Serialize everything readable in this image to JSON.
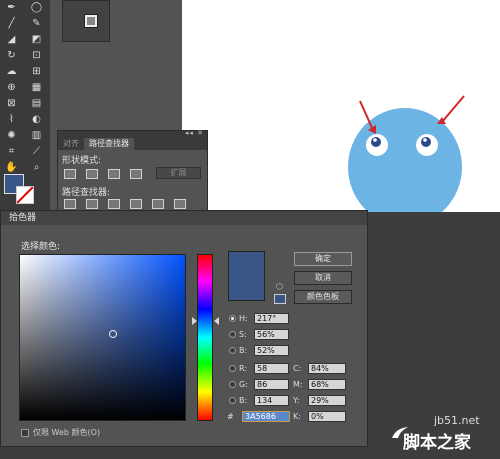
{
  "toolbar": {
    "tools": [
      [
        "pen-icon",
        "ellipse-icon"
      ],
      [
        "brush-icon",
        "pencil-icon"
      ],
      [
        "blob-brush-icon",
        "eraser-icon"
      ],
      [
        "rotate-icon",
        "scale-icon"
      ],
      [
        "warp-icon",
        "free-transform-icon"
      ],
      [
        "shape-builder-icon",
        "perspective-icon"
      ],
      [
        "mesh-icon",
        "gradient-icon"
      ],
      [
        "eyedropper-icon",
        "blend-icon"
      ],
      [
        "symbol-sprayer-icon",
        "graph-icon"
      ],
      [
        "artboard-icon",
        "slice-icon"
      ],
      [
        "hand-icon",
        "zoom-icon"
      ]
    ]
  },
  "pathfinder": {
    "tab_align": "对齐",
    "tab_pathfinder": "路径查找器",
    "shape_modes_label": "形状模式:",
    "pathfinders_label": "路径查找器:",
    "expand_label": "扩展"
  },
  "dialog": {
    "title": "拾色器",
    "select_color_label": "选择颜色:",
    "ok_label": "确定",
    "cancel_label": "取消",
    "swatches_label": "颜色色板",
    "web_only_label": "仅限 Web 颜色(O)",
    "current_color": "#3A5686",
    "fields": {
      "H": {
        "label": "H:",
        "value": "217°"
      },
      "S": {
        "label": "S:",
        "value": "56%"
      },
      "B": {
        "label": "B:",
        "value": "52%"
      },
      "R": {
        "label": "R:",
        "value": "58"
      },
      "G": {
        "label": "G:",
        "value": "86"
      },
      "B2": {
        "label": "B:",
        "value": "134"
      },
      "C": {
        "label": "C:",
        "value": "84%"
      },
      "M": {
        "label": "M:",
        "value": "68%"
      },
      "Y": {
        "label": "Y:",
        "value": "29%"
      },
      "K": {
        "label": "K:",
        "value": "0%"
      },
      "hex": {
        "label": "#",
        "value": "3A5686"
      }
    }
  },
  "watermark": {
    "site": "jb51.net",
    "name": "脚本之家"
  },
  "colors": {
    "mascot_body": "#6CB4E4",
    "arrow": "#d0262d",
    "eye_pupil": "#2a4a8a"
  }
}
